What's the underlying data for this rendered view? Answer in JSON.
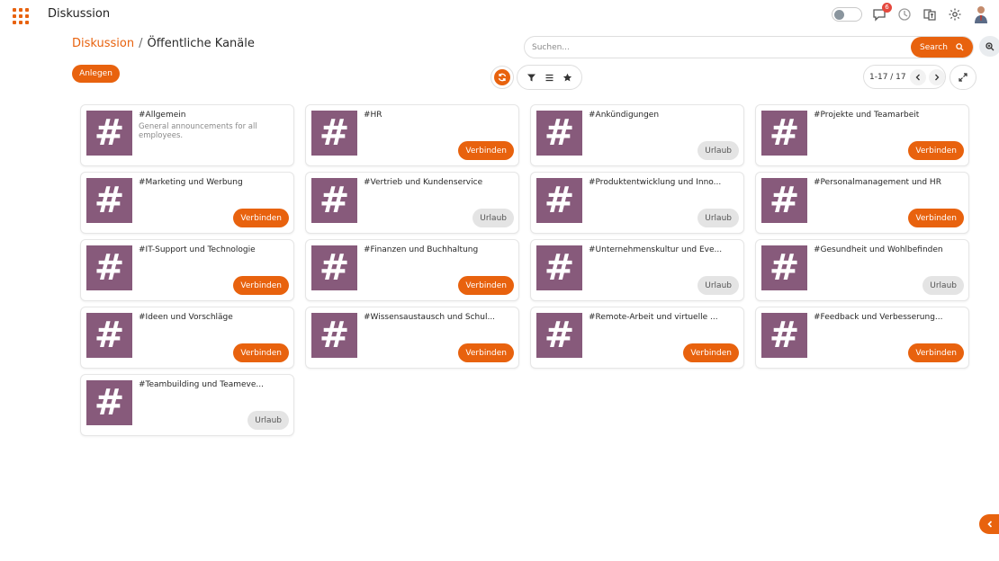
{
  "navbar": {
    "app_title": "Diskussion",
    "apps_icon_color": "#e8620e",
    "notification_count": "6"
  },
  "breadcrumb": {
    "parent": "Diskussion",
    "separator": "/",
    "current": "Öffentliche Kanäle"
  },
  "search": {
    "placeholder": "Suchen...",
    "button_label": "Search"
  },
  "toolbar": {
    "create_label": "Anlegen"
  },
  "pager": {
    "value": "1-17 / 17"
  },
  "colors": {
    "accent": "#e8620e",
    "channel_tile": "#875a7b",
    "leave_button": "#e4e4e4"
  },
  "channels": [
    {
      "name": "#Allgemein",
      "description": "General announcements for all employees.",
      "action": "",
      "action_type": "none"
    },
    {
      "name": "#HR",
      "description": "",
      "action": "Verbinden",
      "action_type": "join"
    },
    {
      "name": "#Ankündigungen",
      "description": "",
      "action": "Urlaub",
      "action_type": "leave"
    },
    {
      "name": "#Projekte und Teamarbeit",
      "description": "",
      "action": "Verbinden",
      "action_type": "join"
    },
    {
      "name": "#Marketing und Werbung",
      "description": "",
      "action": "Verbinden",
      "action_type": "join"
    },
    {
      "name": "#Vertrieb und Kundenservice",
      "description": "",
      "action": "Urlaub",
      "action_type": "leave"
    },
    {
      "name": "#Produktentwicklung und Inno...",
      "description": "",
      "action": "Urlaub",
      "action_type": "leave"
    },
    {
      "name": "#Personalmanagement und HR",
      "description": "",
      "action": "Verbinden",
      "action_type": "join"
    },
    {
      "name": "#IT-Support und Technologie",
      "description": "",
      "action": "Verbinden",
      "action_type": "join"
    },
    {
      "name": "#Finanzen und Buchhaltung",
      "description": "",
      "action": "Verbinden",
      "action_type": "join"
    },
    {
      "name": "#Unternehmenskultur und Eve...",
      "description": "",
      "action": "Urlaub",
      "action_type": "leave"
    },
    {
      "name": "#Gesundheit und Wohlbefinden",
      "description": "",
      "action": "Urlaub",
      "action_type": "leave"
    },
    {
      "name": "#Ideen und Vorschläge",
      "description": "",
      "action": "Verbinden",
      "action_type": "join"
    },
    {
      "name": "#Wissensaustausch und Schul...",
      "description": "",
      "action": "Verbinden",
      "action_type": "join"
    },
    {
      "name": "#Remote-Arbeit und virtuelle ...",
      "description": "",
      "action": "Verbinden",
      "action_type": "join"
    },
    {
      "name": "#Feedback und Verbesserung...",
      "description": "",
      "action": "Verbinden",
      "action_type": "join"
    },
    {
      "name": "#Teambuilding und Teameve...",
      "description": "",
      "action": "Urlaub",
      "action_type": "leave"
    }
  ],
  "channel_tile_glyph": "#"
}
